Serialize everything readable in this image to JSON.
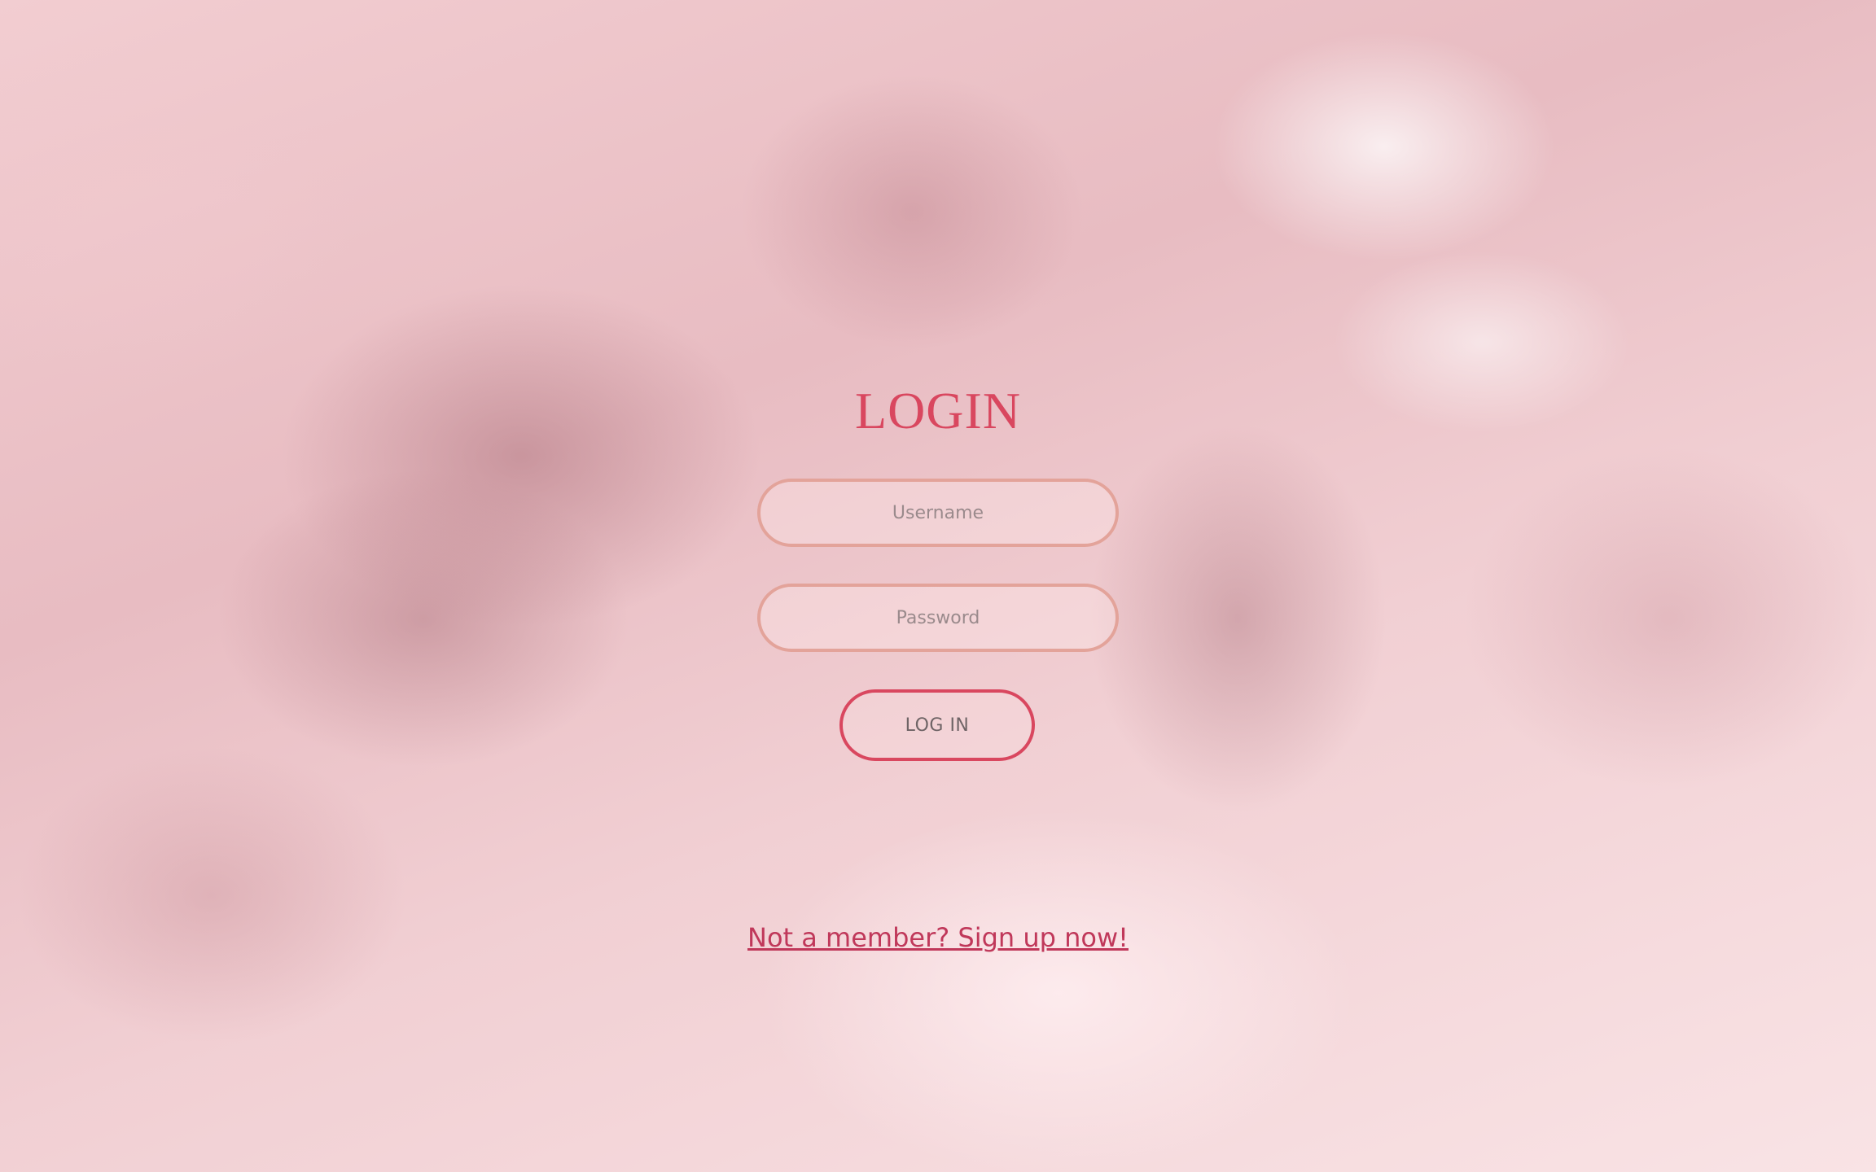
{
  "page": {
    "title": "LOGIN"
  },
  "form": {
    "username_placeholder": "Username",
    "password_placeholder": "Password",
    "login_label": "LOG IN"
  },
  "footer": {
    "signup_link": "Not a member? Sign up now!"
  },
  "colors": {
    "accent": "#d9475f",
    "field_border": "#e3a39a",
    "link": "#c0385a",
    "background": "#f3d4d6"
  }
}
